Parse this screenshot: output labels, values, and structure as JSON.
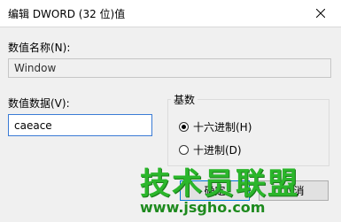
{
  "dialog": {
    "title": "编辑 DWORD (32 位)值"
  },
  "value_name": {
    "label": "数值名称(N):",
    "value": "Window"
  },
  "value_data": {
    "label": "数值数据(V):",
    "value": "caeace"
  },
  "base": {
    "legend": "基数",
    "options": [
      {
        "label": "十六进制(H)",
        "selected": true
      },
      {
        "label": "十进制(D)",
        "selected": false
      }
    ]
  },
  "buttons": {
    "ok_label": "确定",
    "cancel_label": "取消"
  },
  "watermark": {
    "logo_text": "技术员联盟",
    "url": "www.jsgho.com"
  },
  "colors": {
    "input_focus_border": "#3a7bd5",
    "watermark_green": "#2bb62b"
  },
  "icons": {
    "close": "close-icon"
  }
}
